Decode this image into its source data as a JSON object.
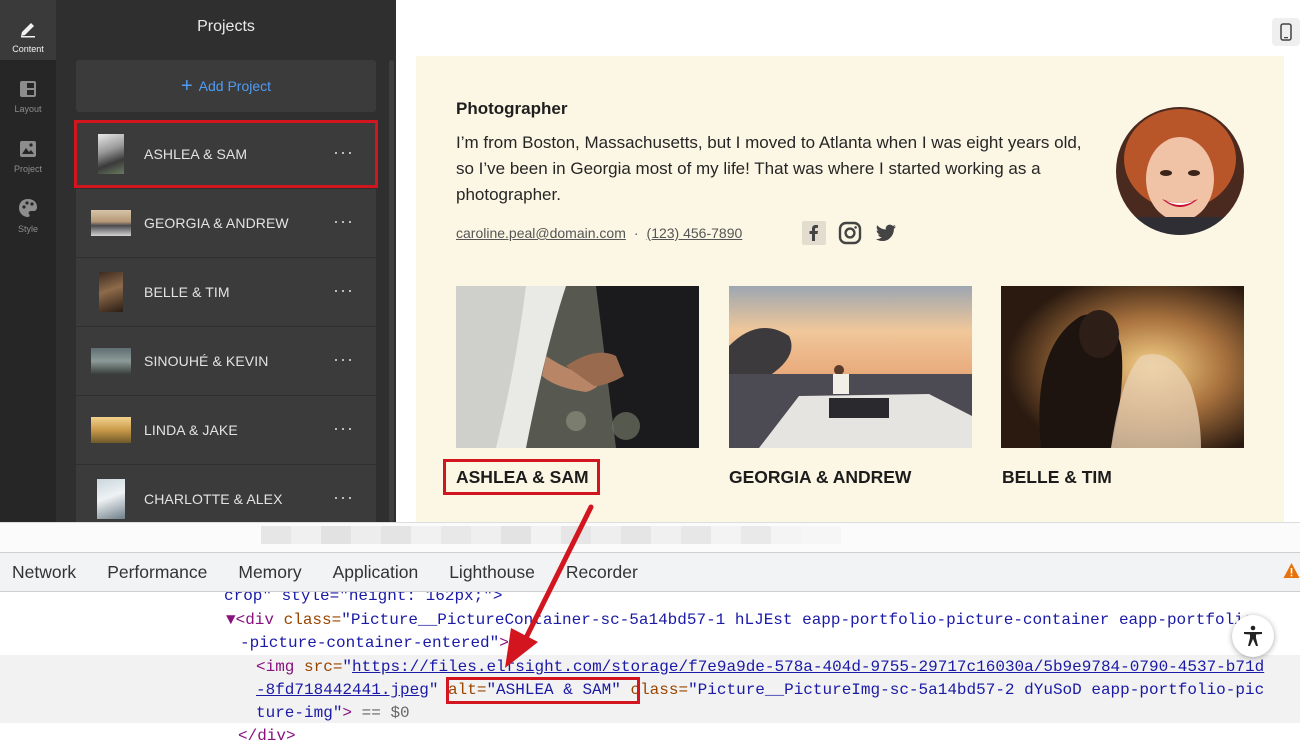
{
  "rail": {
    "items": [
      {
        "label": "Content",
        "icon": "pencil-icon"
      },
      {
        "label": "Layout",
        "icon": "layout-icon"
      },
      {
        "label": "Project",
        "icon": "image-icon"
      },
      {
        "label": "Style",
        "icon": "palette-icon"
      }
    ]
  },
  "panel": {
    "title": "Projects",
    "add_label": "Add Project",
    "more_glyph": "···",
    "projects": [
      {
        "name": "ASHLEA & SAM"
      },
      {
        "name": "GEORGIA & ANDREW"
      },
      {
        "name": "BELLE & TIM"
      },
      {
        "name": "SINOUHÉ & KEVIN"
      },
      {
        "name": "LINDA & JAKE"
      },
      {
        "name": "CHARLOTTE & ALEX"
      }
    ]
  },
  "preview": {
    "role": "Photographer",
    "bio": "I’m from Boston, Massachusetts, but I moved to Atlanta when I was eight years old, so I’ve been in Georgia most of my life! That was where I started working as a photographer.",
    "email": "caroline.peal@domain.com",
    "separator": "·",
    "phone": "(123) 456-7890",
    "socials": [
      "facebook-icon",
      "instagram-icon",
      "twitter-icon"
    ],
    "portfolio": [
      {
        "title": "ASHLEA & SAM"
      },
      {
        "title": "GEORGIA & ANDREW"
      },
      {
        "title": "BELLE & TIM"
      }
    ]
  },
  "devtools": {
    "tabs": [
      "Network",
      "Performance",
      "Memory",
      "Application",
      "Lighthouse",
      "Recorder"
    ],
    "code": {
      "l1": "crop\" style=\"height: 162px;\">",
      "l2_tag": "▼<div ",
      "l2_attr": "class=",
      "l2_val": "\"Picture__PictureContainer-sc-5a14bd57-1 hLJEst eapp-portfolio-picture-container eapp-portfolio",
      "l3_val": "-picture-container-entered\"",
      "l3_tag": ">",
      "l4_tag": "<img ",
      "l4_attr": "src=",
      "l4_q": "\"",
      "l4_link": "https://files.elfsight.com/storage/f7e9a9de-578a-404d-9755-29717c16030a/5b9e9784-0790-4537-b71d",
      "l5_link": "-8fd718442441.jpeg",
      "l5_q": "\" ",
      "l5_alt_attr": "alt=",
      "l5_alt_val": "\"ASHLEA & SAM\"",
      "l5_class_attr": " class=",
      "l5_class_val": "\"Picture__PictureImg-sc-5a14bd57-2 dYuSoD eapp-portfolio-pic",
      "l6_val": "ture-img\"",
      "l6_tag": ">",
      "l6_grey": " == $0",
      "l7_tag": "</div>"
    }
  },
  "colors": {
    "accent_blue": "#4f9cf5",
    "highlight_red": "#d2151f",
    "card_bg": "#fcf6e4",
    "panel_bg": "#2f2f2f"
  }
}
